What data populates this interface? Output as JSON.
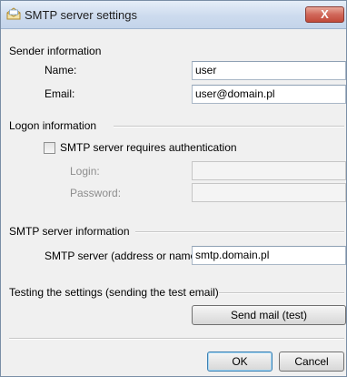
{
  "window": {
    "title": "SMTP server settings",
    "close_glyph": "X"
  },
  "sender": {
    "section_label": "Sender information",
    "name_label": "Name:",
    "name_value": "user",
    "email_label": "Email:",
    "email_value": "user@domain.pl"
  },
  "logon": {
    "section_label": "Logon information",
    "auth_checkbox_label": "SMTP server requires authentication",
    "auth_checked": false,
    "login_label": "Login:",
    "login_value": "",
    "password_label": "Password:",
    "password_value": ""
  },
  "smtp": {
    "section_label": "SMTP server information",
    "server_label": "SMTP server (address or name):",
    "server_value": "smtp.domain.pl"
  },
  "testing": {
    "section_label": "Testing the settings (sending the test email)",
    "send_button": "Send mail (test)"
  },
  "footer": {
    "ok_button": "OK",
    "cancel_button": "Cancel"
  },
  "colors": {
    "titlebar": "#cddbee",
    "close": "#c24a3a",
    "background": "#f0f0f0"
  }
}
